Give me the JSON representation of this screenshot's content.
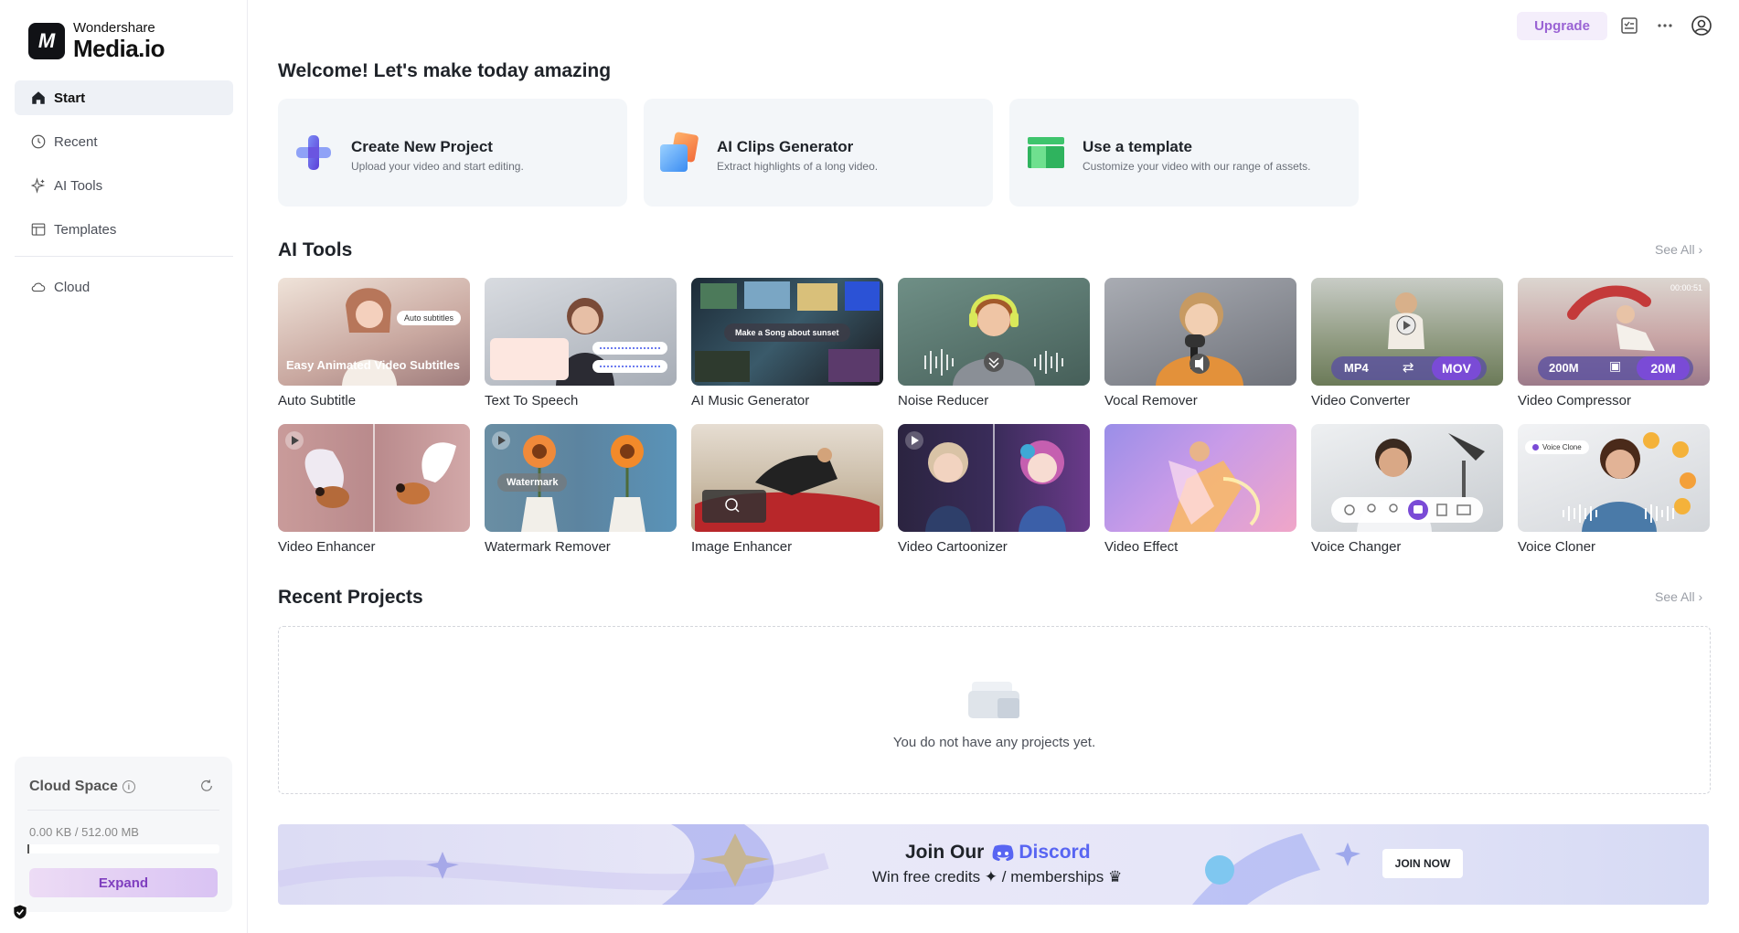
{
  "app": {
    "logo_small": "Wondershare",
    "logo_big": "Media.io",
    "logo_mark": "M"
  },
  "sidebar": {
    "items": [
      {
        "label": "Start",
        "icon": "home-icon",
        "active": true
      },
      {
        "label": "Recent",
        "icon": "clock-icon"
      },
      {
        "label": "AI Tools",
        "icon": "sparkle-icon"
      },
      {
        "label": "Templates",
        "icon": "template-icon"
      },
      {
        "label": "Cloud",
        "icon": "cloud-icon"
      }
    ],
    "cloud": {
      "title": "Cloud Space",
      "usage": "0.00 KB / 512.00 MB",
      "used_fraction": 0.0,
      "expand_label": "Expand"
    }
  },
  "topbar": {
    "upgrade_label": "Upgrade"
  },
  "main": {
    "welcome": "Welcome! Let's make today amazing",
    "actions": [
      {
        "title": "Create New Project",
        "subtitle": "Upload your video and start editing."
      },
      {
        "title": "AI Clips Generator",
        "subtitle": "Extract highlights of a long video."
      },
      {
        "title": "Use a template",
        "subtitle": "Customize your video with our range of assets."
      }
    ],
    "ai_tools_title": "AI Tools",
    "see_all": "See All",
    "tools": [
      {
        "label": "Auto Subtitle",
        "overlay": "Easy Animated Video Subtitles",
        "badge": "Auto subtitles"
      },
      {
        "label": "Text To Speech"
      },
      {
        "label": "AI Music Generator",
        "overlay": "Make a Song about sunset"
      },
      {
        "label": "Noise Reducer"
      },
      {
        "label": "Vocal Remover"
      },
      {
        "label": "Video Converter",
        "from": "MP4",
        "to": "MOV"
      },
      {
        "label": "Video Compressor",
        "from": "200M",
        "to": "20M",
        "time": "00:00:51"
      },
      {
        "label": "Video Enhancer"
      },
      {
        "label": "Watermark Remover",
        "overlay": "Watermark"
      },
      {
        "label": "Image Enhancer"
      },
      {
        "label": "Video Cartoonizer"
      },
      {
        "label": "Video Effect"
      },
      {
        "label": "Voice Changer"
      },
      {
        "label": "Voice Cloner",
        "badge": "Voice Clone"
      }
    ],
    "recent_title": "Recent Projects",
    "empty_text": "You do not have any projects yet.",
    "banner": {
      "title_prefix": "Join Our",
      "discord": "Discord",
      "subtitle": "Win free credits ✦ / memberships ♛",
      "join_label": "JOIN NOW"
    }
  }
}
